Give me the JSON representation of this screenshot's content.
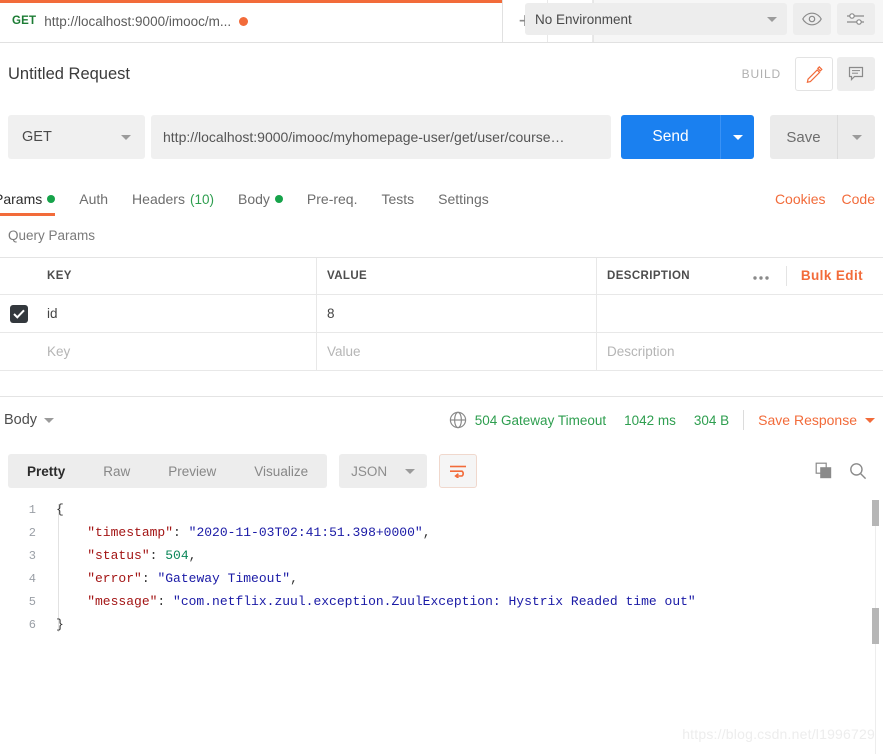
{
  "tab_bar": {
    "request_tab": {
      "method": "GET",
      "name": "http://localhost:9000/imooc/m...",
      "unsaved": "●"
    },
    "new_tab_label": "+",
    "more_label": "●●●",
    "environment": {
      "selected": "No Environment"
    },
    "eye_icon": "eye-icon",
    "settings_icon": "sliders-icon"
  },
  "request_header": {
    "title": "Untitled Request",
    "build_label": "BUILD",
    "edit_icon": "pencil-icon",
    "comment_icon": "comment-icon"
  },
  "url_bar": {
    "method": "GET",
    "url": "http://localhost:9000/imooc/myhomepage-user/get/user/course…",
    "send_label": "Send",
    "save_label": "Save"
  },
  "request_tabs": {
    "items": [
      {
        "label": "Params",
        "active": true,
        "dot": true
      },
      {
        "label": "Auth",
        "active": false,
        "dot": false
      },
      {
        "label": "Headers",
        "count": "(10)",
        "active": false,
        "dot": false
      },
      {
        "label": "Body",
        "active": false,
        "dot": true
      },
      {
        "label": "Pre-req.",
        "active": false,
        "dot": false
      },
      {
        "label": "Tests",
        "active": false,
        "dot": false
      },
      {
        "label": "Settings",
        "active": false,
        "dot": false
      }
    ],
    "cookies_link": "Cookies",
    "code_link": "Code"
  },
  "query_params": {
    "section_label": "Query Params",
    "columns": {
      "key": "KEY",
      "value": "VALUE",
      "description": "DESCRIPTION"
    },
    "more_label": "●●●",
    "bulk_edit_label": "Bulk Edit",
    "rows": [
      {
        "checked": true,
        "key": "id",
        "value": "8",
        "description": ""
      }
    ],
    "placeholders": {
      "key": "Key",
      "value": "Value",
      "description": "Description"
    }
  },
  "response": {
    "body_menu_label": "Body",
    "globe_icon": "globe-icon",
    "status_text": "504 Gateway Timeout",
    "time_text": "1042 ms",
    "size_text": "304 B",
    "save_response_label": "Save Response",
    "status_color": "#2e9e4f",
    "accent_color": "#f26b3a",
    "view_tabs": [
      {
        "label": "Pretty",
        "active": true
      },
      {
        "label": "Raw",
        "active": false
      },
      {
        "label": "Preview",
        "active": false
      },
      {
        "label": "Visualize",
        "active": false
      }
    ],
    "format": "JSON",
    "wrap_icon": "word-wrap-icon",
    "copy_icon": "copy-icon",
    "search_icon": "search-icon",
    "code_lines": [
      {
        "num": "1",
        "tokens": [
          {
            "t": "{",
            "c": "p"
          }
        ]
      },
      {
        "num": "2",
        "tokens": [
          {
            "t": "    \"timestamp\"",
            "c": "k"
          },
          {
            "t": ": ",
            "c": "p"
          },
          {
            "t": "\"2020-11-03T02:41:51.398+0000\"",
            "c": "s"
          },
          {
            "t": ",",
            "c": "p"
          }
        ]
      },
      {
        "num": "3",
        "tokens": [
          {
            "t": "    \"status\"",
            "c": "k"
          },
          {
            "t": ": ",
            "c": "p"
          },
          {
            "t": "504",
            "c": "n"
          },
          {
            "t": ",",
            "c": "p"
          }
        ]
      },
      {
        "num": "4",
        "tokens": [
          {
            "t": "    \"error\"",
            "c": "k"
          },
          {
            "t": ": ",
            "c": "p"
          },
          {
            "t": "\"Gateway Timeout\"",
            "c": "s"
          },
          {
            "t": ",",
            "c": "p"
          }
        ]
      },
      {
        "num": "5",
        "tokens": [
          {
            "t": "    \"message\"",
            "c": "k"
          },
          {
            "t": ": ",
            "c": "p"
          },
          {
            "t": "\"com.netflix.zuul.exception.ZuulException: Hystrix Readed time out\"",
            "c": "s"
          }
        ]
      },
      {
        "num": "6",
        "tokens": [
          {
            "t": "}",
            "c": "p"
          }
        ]
      }
    ]
  },
  "watermark": "https://blog.csdn.net/l1996729"
}
